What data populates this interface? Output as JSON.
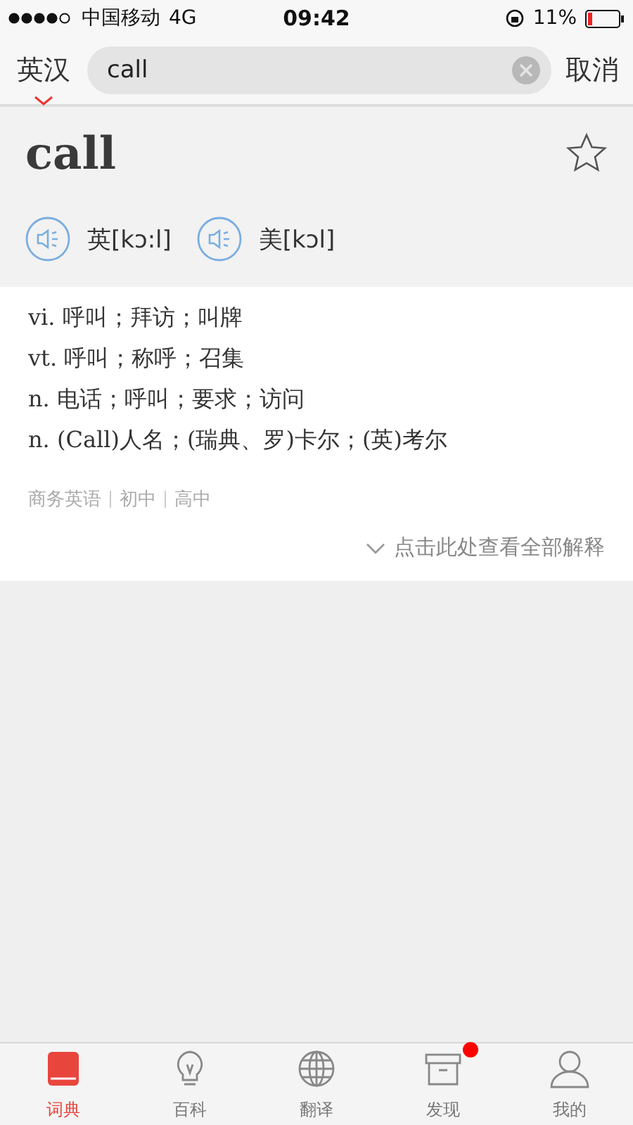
{
  "status_bar": {
    "carrier": "中国移动",
    "network": "4G",
    "time": "09:42",
    "battery": "11%"
  },
  "search": {
    "dict": "英汉",
    "value": "call",
    "cancel": "取消"
  },
  "word": {
    "headword": "call",
    "starred": false,
    "pronunciations": [
      {
        "label": "英[kɔ:l]"
      },
      {
        "label": "美[kɔl]"
      }
    ]
  },
  "definitions": [
    "vi. 呼叫；拜访；叫牌",
    "vt. 呼叫；称呼；召集",
    "n. 电话；呼叫；要求；访问",
    "n. (Call)人名；(瑞典、罗)卡尔；(英)考尔"
  ],
  "tags": [
    "商务英语",
    "初中",
    "高中"
  ],
  "more": "点击此处查看全部解释",
  "tabs": [
    {
      "label": "词典",
      "kind": "book",
      "selected": true,
      "badge": false
    },
    {
      "label": "百科",
      "kind": "bulb",
      "selected": false,
      "badge": false
    },
    {
      "label": "翻译",
      "kind": "globe",
      "selected": false,
      "badge": false
    },
    {
      "label": "发现",
      "kind": "box",
      "selected": false,
      "badge": true
    },
    {
      "label": "我的",
      "kind": "person",
      "selected": false,
      "badge": false
    }
  ]
}
